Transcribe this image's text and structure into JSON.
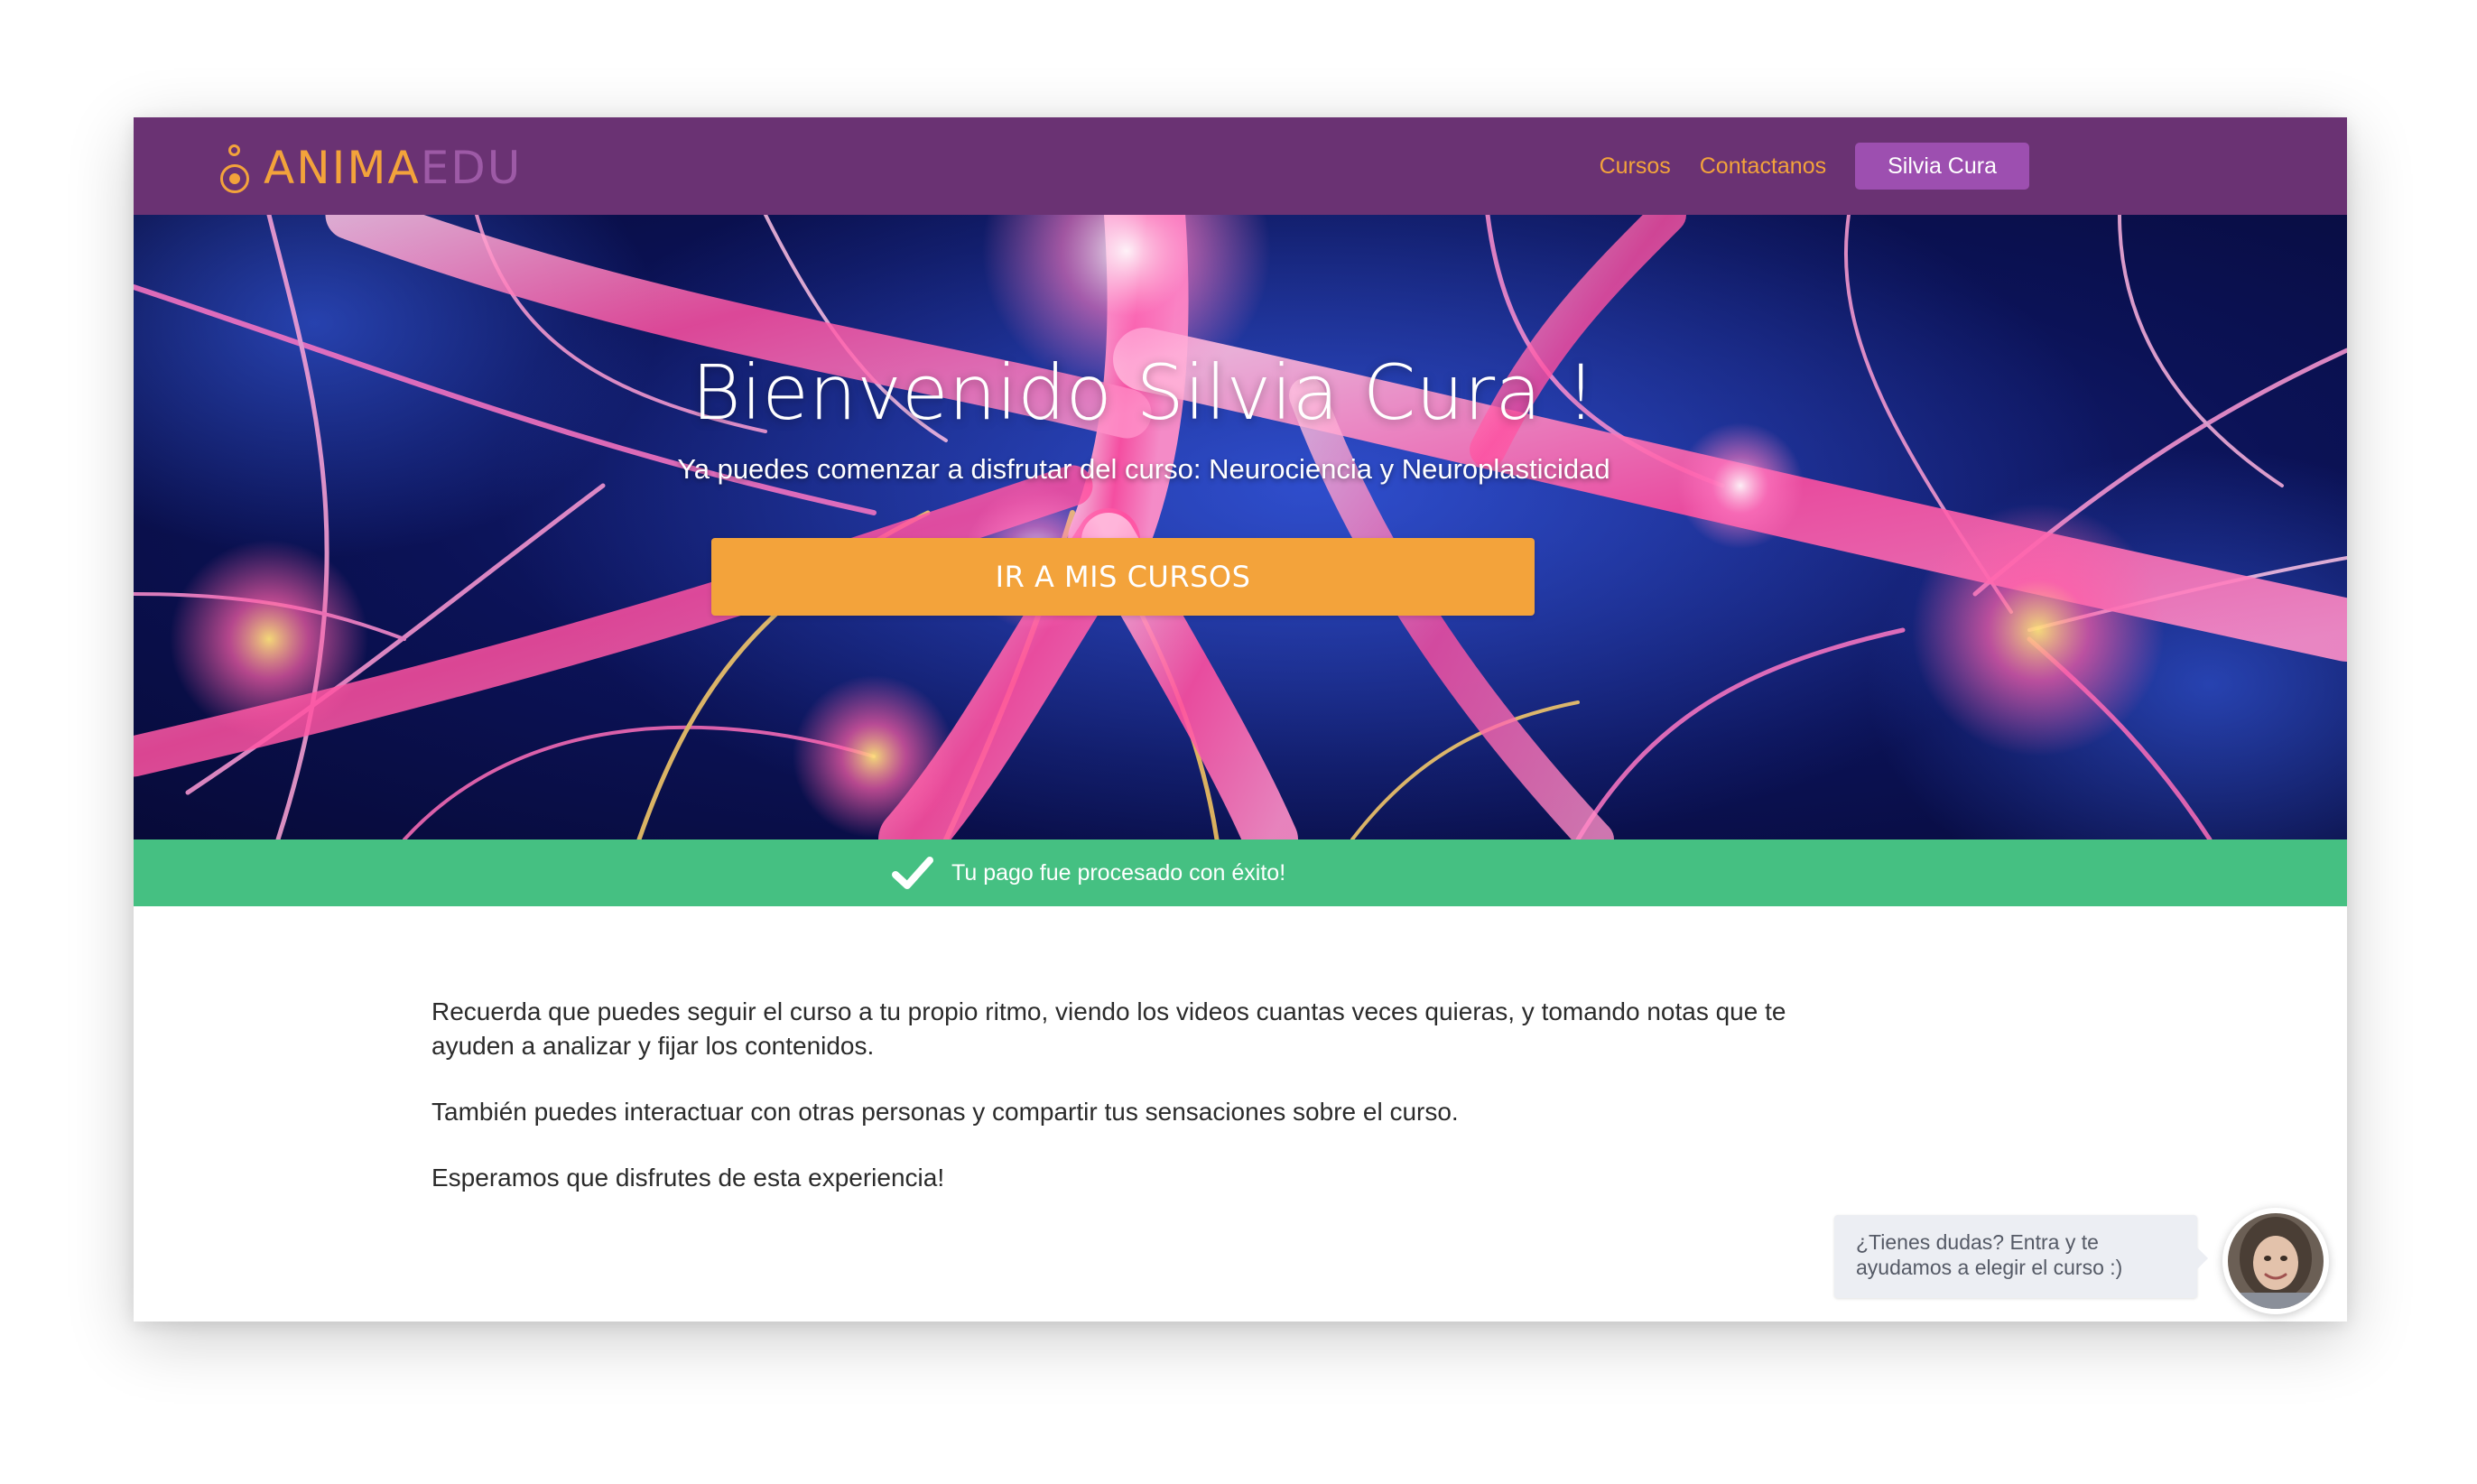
{
  "navbar": {
    "logo": {
      "part1": "ANIMA",
      "part2": "EDU"
    },
    "links": [
      {
        "label": "Cursos"
      },
      {
        "label": "Contactanos"
      }
    ],
    "user_button": "Silvia Cura"
  },
  "hero": {
    "title": "Bienvenido Silvia Cura !",
    "subtitle": "Ya puedes comenzar a disfrutar del curso: Neurociencia y Neuroplasticidad",
    "button_label": "IR A MIS CURSOS"
  },
  "success": {
    "icon": "checkmark-icon",
    "message": "Tu pago fue procesado con éxito!"
  },
  "content": {
    "paragraphs": [
      "Recuerda que puedes seguir el curso a tu propio ritmo, viendo los videos cuantas veces quieras, y tomando notas que te ayuden a analizar y fijar los contenidos.",
      "También puedes interactuar con otras personas y compartir tus sensaciones sobre el curso.",
      "Esperamos que disfrutes de esta experiencia!"
    ]
  },
  "chat": {
    "message": "¿Tienes dudas? Entra y te ayudamos a elegir el curso :)",
    "avatar_icon": "support-agent-avatar"
  },
  "colors": {
    "navbar": "#6a3273",
    "accent_orange": "#f3a33b",
    "user_button": "#9d4fb0",
    "success_green": "#45c082",
    "chat_bubble": "#eceef3"
  }
}
